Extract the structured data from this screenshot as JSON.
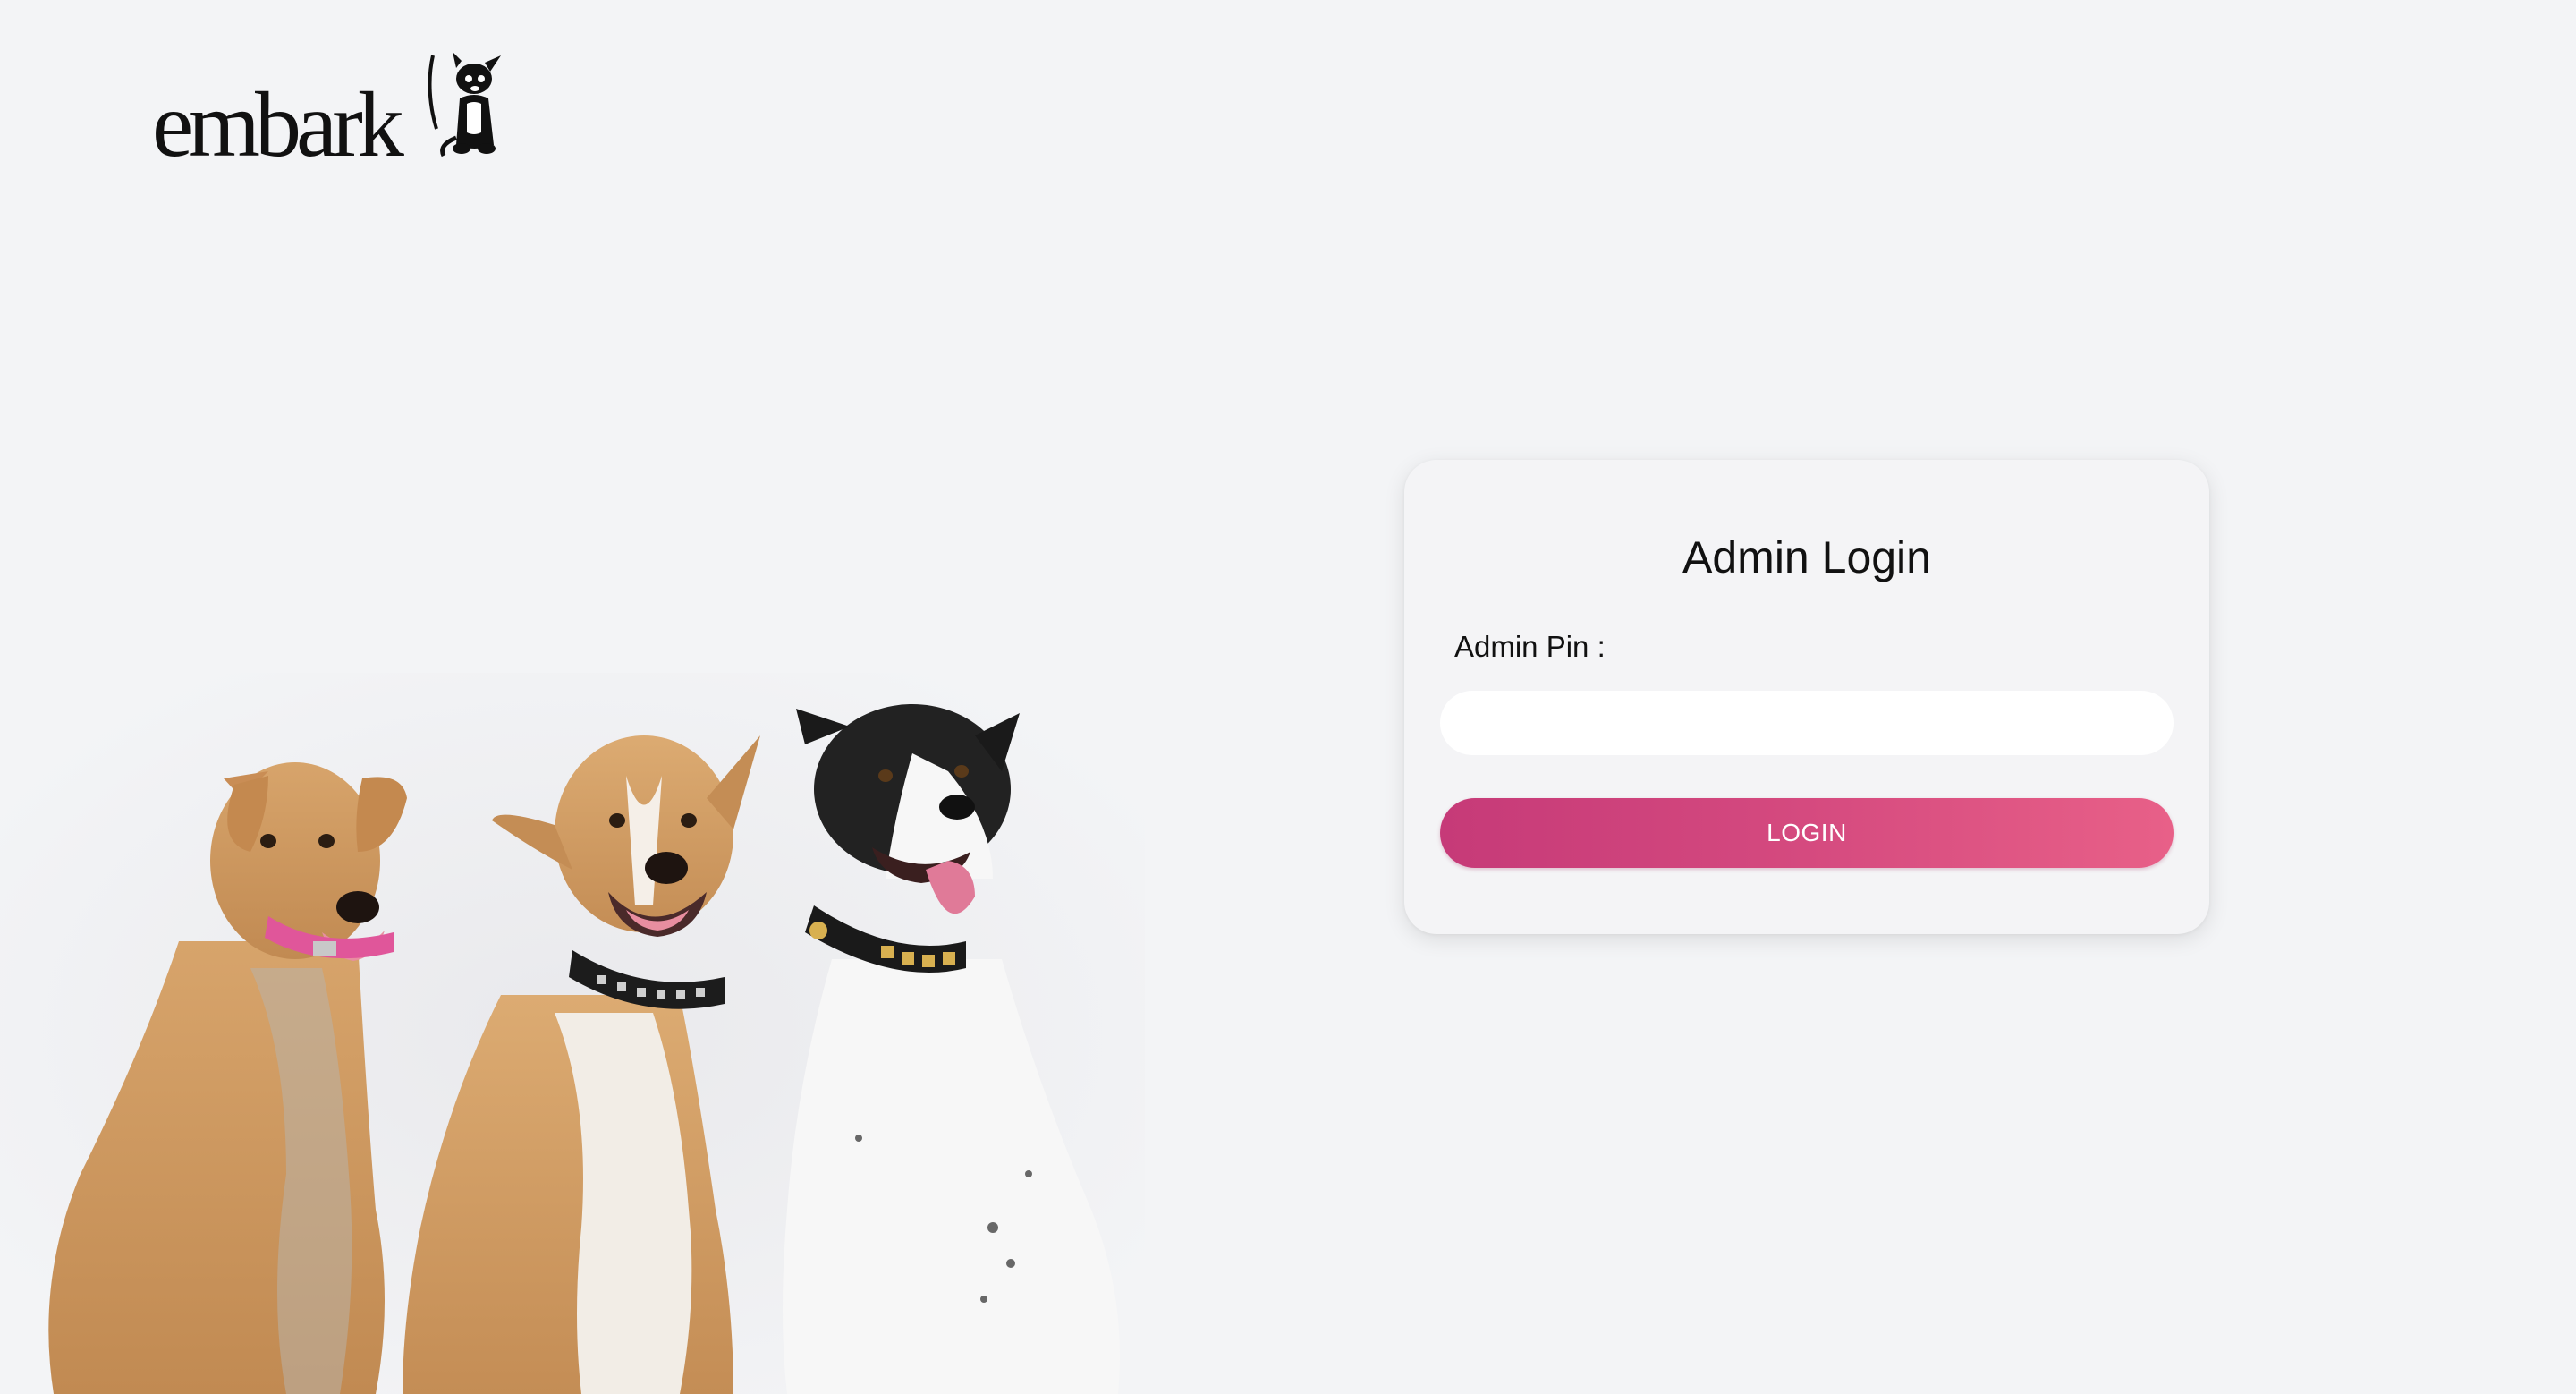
{
  "brand": {
    "logo_text": "embark",
    "logo_icon": "dog-icon"
  },
  "hero": {
    "image": "three-dogs-photo",
    "dogs": [
      {
        "coat": "tan",
        "collar_color": "#e0569a"
      },
      {
        "coat": "tan-white",
        "collar_color": "#222222"
      },
      {
        "coat": "black-white",
        "collar_color": "#1a1a1a"
      }
    ]
  },
  "login": {
    "title": "Admin Login",
    "pin_label": "Admin Pin :",
    "pin_value": "",
    "pin_placeholder": "",
    "button_label": "LOGIN"
  },
  "colors": {
    "background": "#f3f4f6",
    "card": "#f4f4f6",
    "button_start": "#c63a78",
    "button_end": "#e86088"
  }
}
